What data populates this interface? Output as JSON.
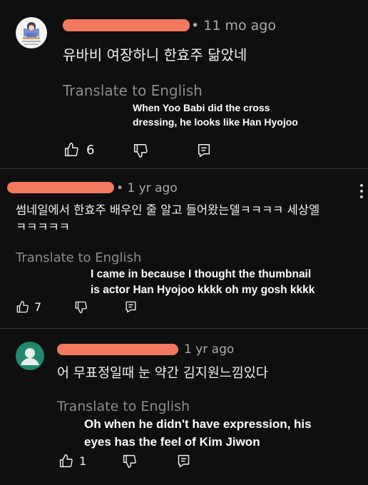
{
  "comments": [
    {
      "time": "• 11 mo ago",
      "body": "유바비 여장하니 한효주 닮았네",
      "translate_label": "Translate to English",
      "translation_lines": [
        "When Yoo Babi did the cross",
        "dressing, he looks like Han Hyojoo"
      ],
      "likes": "6",
      "avatar_type": "illustration"
    },
    {
      "time": "• 1 yr ago",
      "body_lines": [
        "썸네일에서 한효주 배우인 줄 알고 들어왔는델ㅋㅋㅋㅋ 세상엘",
        "ㅋㅋㅋㅋㅋ"
      ],
      "translate_label": "Translate to English",
      "translation_lines": [
        "I came in because I thought the thumbnail",
        "is actor Han Hyojoo kkkk oh my gosh kkkk"
      ],
      "likes": "7"
    },
    {
      "time": "1 yr ago",
      "body": "어 무표정일때 눈 약간 김지원느낌있다",
      "translate_label": "Translate to English",
      "translation_lines": [
        "Oh when he didn't have expression, his",
        "eyes has the feel of Kim Jiwon"
      ],
      "likes": "1",
      "avatar_type": "default-person",
      "avatar_color": "#1f8a70"
    }
  ],
  "colors": {
    "background": "#0f0f0f",
    "redaction": "#f2785f",
    "meta_text": "#aaaaaa",
    "translate_text": "#8d8d8d"
  },
  "icons": [
    "thumbs-up-icon",
    "thumbs-down-icon",
    "reply-icon",
    "more-vertical-icon"
  ]
}
